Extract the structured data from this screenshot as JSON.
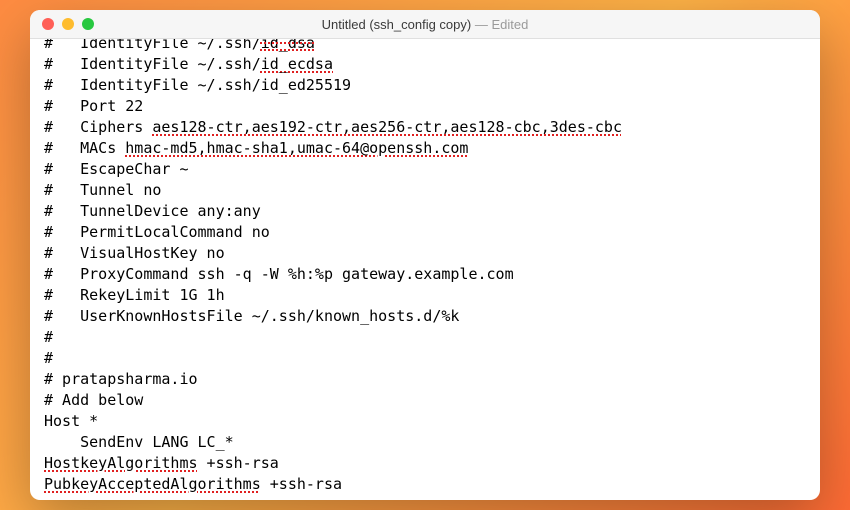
{
  "window": {
    "title_main": "Untitled (ssh_config copy)",
    "title_sep": " — ",
    "title_status": "Edited"
  },
  "editor": {
    "lines": [
      {
        "pre": "#   ",
        "rest_cutoff_lead": "IdentityFile ~/.ssh/",
        "rest_cutoff_spell": "id_dsa"
      },
      {
        "pre": "#   IdentityFile ~/.ssh/",
        "spell": "id_ecdsa"
      },
      {
        "pre": "#   IdentityFile ~/.ssh/id_ed25519"
      },
      {
        "pre": "#   Port 22"
      },
      {
        "pre": "#   Ciphers ",
        "spell": "aes128-ctr,aes192-ctr,aes256-ctr,aes128-cbc,3des-cbc"
      },
      {
        "pre": "#   MACs ",
        "spell": "hmac-md5,hmac-sha1,umac-64@openssh.com"
      },
      {
        "pre": "#   EscapeChar ~"
      },
      {
        "pre": "#   Tunnel no"
      },
      {
        "pre": "#   TunnelDevice any:any"
      },
      {
        "pre": "#   PermitLocalCommand no"
      },
      {
        "pre": "#   VisualHostKey no"
      },
      {
        "pre": "#   ProxyCommand ssh -q -W %h:%p gateway.example.com"
      },
      {
        "pre": "#   RekeyLimit 1G 1h"
      },
      {
        "pre": "#   UserKnownHostsFile ~/.ssh/known_hosts.d/%k"
      },
      {
        "pre": "#"
      },
      {
        "pre": "#"
      },
      {
        "pre": "# pratapsharma.io"
      },
      {
        "pre": ""
      },
      {
        "pre": "# Add below"
      },
      {
        "pre": ""
      },
      {
        "pre": "Host *"
      },
      {
        "pre": "    SendEnv LANG LC_*"
      },
      {
        "pre": "",
        "spell": "HostkeyAlgorithms",
        "post": " +ssh-rsa"
      },
      {
        "pre": "",
        "spell": "PubkeyAcceptedAlgorithms",
        "post": " +ssh-rsa"
      }
    ]
  }
}
